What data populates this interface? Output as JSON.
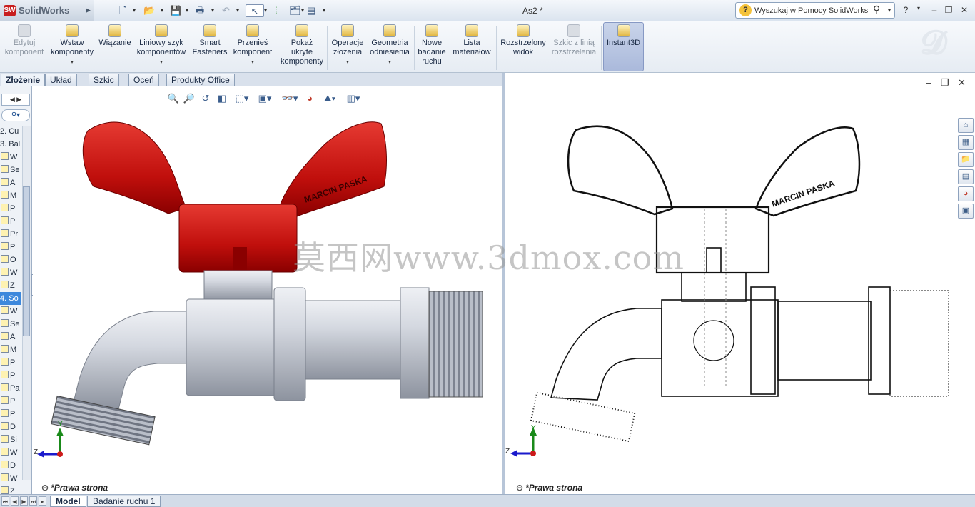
{
  "app": {
    "name": "SolidWorks",
    "document_title": "As2 *",
    "logo_mark": "SW"
  },
  "search": {
    "placeholder": "Wyszukaj w Pomocy SolidWorks"
  },
  "ribbon": [
    {
      "label": "Edytuj\nkomponent",
      "disabled": true,
      "dropdown": false
    },
    {
      "label": "Wstaw\nkomponenty",
      "disabled": false,
      "dropdown": true
    },
    {
      "label": "Wiązanie",
      "disabled": false,
      "dropdown": false
    },
    {
      "label": "Liniowy szyk\nkomponentów",
      "disabled": false,
      "dropdown": true
    },
    {
      "label": "Smart\nFasteners",
      "disabled": false,
      "dropdown": false
    },
    {
      "label": "Przenieś\nkomponent",
      "disabled": false,
      "dropdown": true
    },
    {
      "label": "Pokaż\nukryte\nkomponenty",
      "disabled": false,
      "dropdown": false
    },
    {
      "label": "Operacje\nzłożenia",
      "disabled": false,
      "dropdown": true
    },
    {
      "label": "Geometria\nodniesienia",
      "disabled": false,
      "dropdown": true
    },
    {
      "label": "Nowe\nbadanie\nruchu",
      "disabled": false,
      "dropdown": false
    },
    {
      "label": "Lista\nmateriałów",
      "disabled": false,
      "dropdown": false
    },
    {
      "label": "Rozstrzelony\nwidok",
      "disabled": false,
      "dropdown": false
    },
    {
      "label": "Szkic z linią\nrozstrzelenia",
      "disabled": true,
      "dropdown": false
    },
    {
      "label": "Instant3D",
      "disabled": false,
      "dropdown": false,
      "active": true
    }
  ],
  "command_tabs": [
    "Złożenie",
    "Układ",
    "Szkic",
    "Oceń",
    "Produkty Office"
  ],
  "feature_tree": {
    "items": [
      {
        "label": "2. Cu",
        "selected": false
      },
      {
        "label": "3. Bal",
        "selected": false
      },
      {
        "label": "W",
        "selected": false
      },
      {
        "label": "Se",
        "selected": false
      },
      {
        "label": "A",
        "selected": false
      },
      {
        "label": "M",
        "selected": false
      },
      {
        "label": "P",
        "selected": false
      },
      {
        "label": "P",
        "selected": false
      },
      {
        "label": "Pr",
        "selected": false
      },
      {
        "label": "P",
        "selected": false
      },
      {
        "label": "O",
        "selected": false
      },
      {
        "label": "W",
        "selected": false
      },
      {
        "label": "Z",
        "selected": false
      },
      {
        "label": "4. So",
        "selected": true
      },
      {
        "label": "W",
        "selected": false
      },
      {
        "label": "Se",
        "selected": false
      },
      {
        "label": "A",
        "selected": false
      },
      {
        "label": "M",
        "selected": false
      },
      {
        "label": "P",
        "selected": false
      },
      {
        "label": "P",
        "selected": false
      },
      {
        "label": "Pa",
        "selected": false
      },
      {
        "label": "P",
        "selected": false
      },
      {
        "label": "P",
        "selected": false
      },
      {
        "label": "D",
        "selected": false
      },
      {
        "label": "Si",
        "selected": false
      },
      {
        "label": "W",
        "selected": false
      },
      {
        "label": "D",
        "selected": false
      },
      {
        "label": "W",
        "selected": false
      },
      {
        "label": "Z",
        "selected": false
      }
    ]
  },
  "viewports": {
    "left": {
      "view_label": "*Prawa strona",
      "mode": "shaded"
    },
    "right": {
      "view_label": "*Prawa strona",
      "mode": "hidden-lines-visible"
    }
  },
  "model": {
    "engraving": "MARCIN PASKA",
    "handle_color": "#cc0000",
    "body_color": "#c9cdd5"
  },
  "triad": {
    "y_label": "Y",
    "z_label": "Z"
  },
  "watermark": "莫西网www.3dmox.com",
  "bottom_tabs": [
    "Model",
    "Badanie ruchu 1"
  ],
  "colors": {
    "accent": "#3d88dc",
    "selection": "#3d88dc"
  }
}
